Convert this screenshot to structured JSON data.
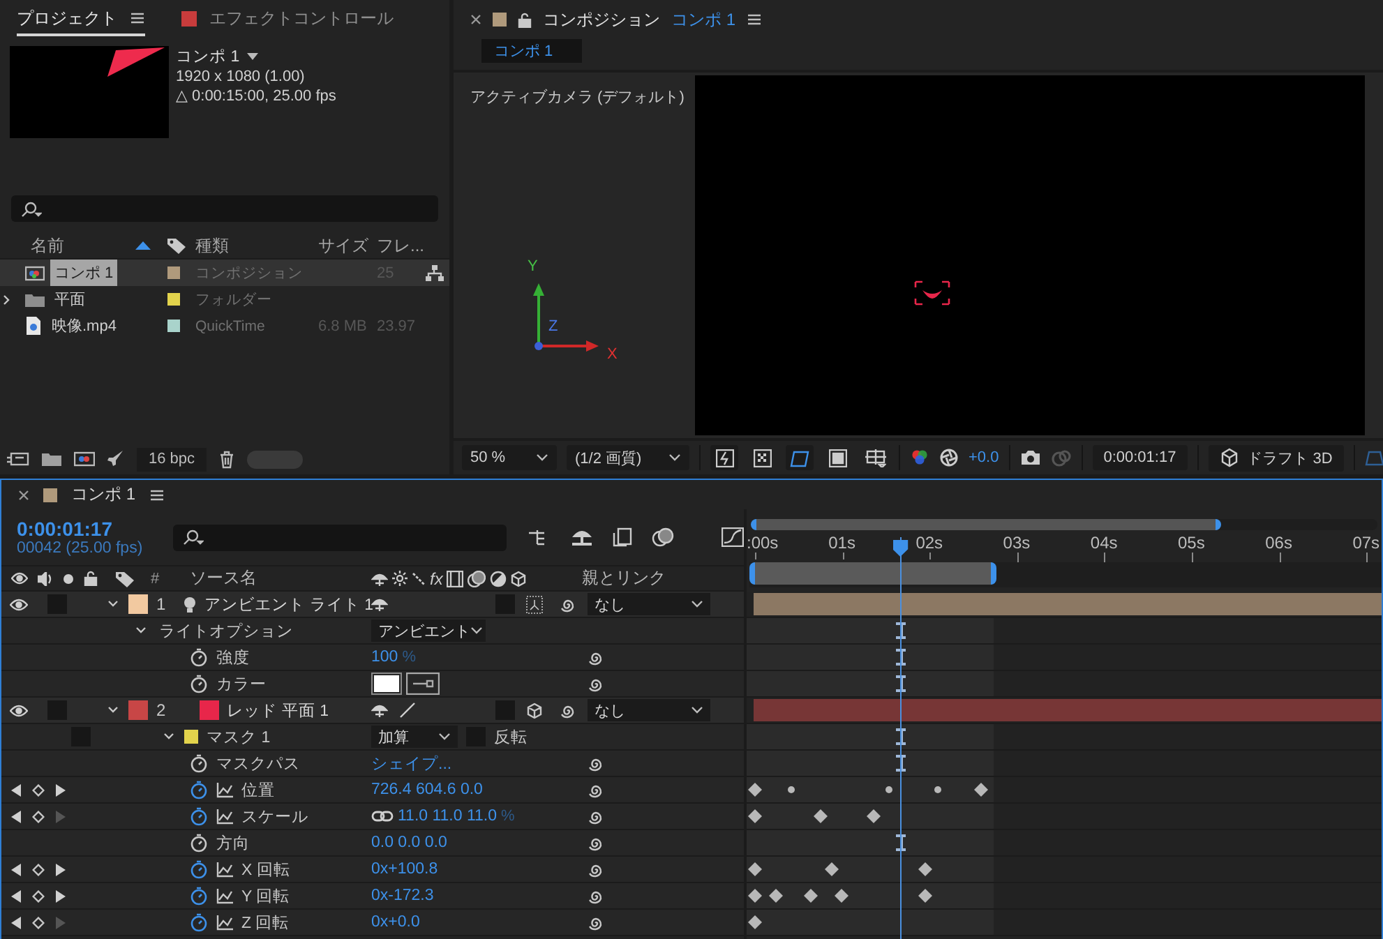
{
  "project": {
    "tabs": [
      {
        "label": "プロジェクト",
        "selected": true
      },
      {
        "label": "エフェクトコントロール",
        "selected": false
      }
    ],
    "preview": {
      "name": "コンポ 1",
      "resolution": "1920 x 1080 (1.00)",
      "duration": "△ 0:00:15:00, 25.00 fps"
    },
    "columns": [
      "名前",
      "種類",
      "サイズ",
      "フレ..."
    ],
    "items": [
      {
        "kind": "comp",
        "name": "コンポ 1",
        "color": "#b09a7c",
        "type": "コンポジション",
        "fps": "25",
        "selected": true
      },
      {
        "kind": "folder",
        "name": "平面",
        "color": "#e2d34c",
        "type": "フォルダー",
        "expanded": false,
        "selected": false
      },
      {
        "kind": "footage",
        "name": "映像.mp4",
        "color": "#a9d3cb",
        "type": "QuickTime",
        "size": "6.8 MB",
        "fps": "23.97",
        "selected": false
      }
    ],
    "bit_depth": "16 bpc"
  },
  "composition": {
    "title": "コンポジション",
    "comp_name": "コンポ 1",
    "tabs": [
      {
        "label": "コンポ 1",
        "selected": true
      }
    ],
    "view_label": "アクティブカメラ (デフォルト)",
    "axes": [
      "Y",
      "Z",
      "X"
    ],
    "zoom": "50 %",
    "resolution": "(1/2 画質)",
    "mask_view": true,
    "exposure": "+0.0",
    "time": "0:00:01:17",
    "renderer": "ドラフト 3D"
  },
  "timeline": {
    "comp_name": "コンポ 1",
    "timecode": "0:00:01:17",
    "frames": "00042 (25.00 fps)",
    "headers": {
      "number": "#",
      "source": "ソース名",
      "effects": "fx",
      "parent": "親とリンク"
    },
    "ruler": [
      ":00s",
      "01s",
      "02s",
      "03s",
      "04s",
      "05s",
      "06s",
      "07s"
    ],
    "navigator": {
      "level": 0.75
    },
    "work_area": {
      "level": 0.39
    },
    "playhead": {
      "level": 0.242
    },
    "layers": [
      {
        "kind": "light",
        "number": "1",
        "name": "アンビエント ライト 1",
        "color": "#f2c9a0",
        "visible": true,
        "expanded": true,
        "parent": "なし",
        "children": [
          {
            "kind": "group",
            "label": "ライトオプション",
            "value": "アンビエント",
            "expanded": true,
            "children": [
              {
                "kind": "property",
                "label": "強度",
                "value": "100",
                "unit": "%",
                "animated": false
              },
              {
                "kind": "color",
                "label": "カラー",
                "animated": false
              }
            ]
          }
        ]
      },
      {
        "kind": "solid",
        "number": "2",
        "name": "レッド 平面 1",
        "color": "#c84646",
        "visible": true,
        "expanded": true,
        "parent": "なし",
        "children": [
          {
            "kind": "mask",
            "label": "マスク 1",
            "color": "#e2d34c",
            "mode": "加算",
            "inverted": false,
            "invert_label": "反転",
            "expanded": true,
            "children": [
              {
                "kind": "property",
                "label": "マスクパス",
                "value": "シェイプ...",
                "animated": false
              }
            ]
          },
          {
            "kind": "property",
            "label": "位置",
            "value": "726.4 604.6 0.0",
            "animated": true,
            "keyframes": [
              {
                "kind": "diamond",
                "level": 0.013
              },
              {
                "kind": "dot",
                "level": 0.07
              },
              {
                "kind": "dot",
                "level": 0.225
              },
              {
                "kind": "dot",
                "level": 0.3
              },
              {
                "kind": "diamond",
                "level": 0.37
              }
            ]
          },
          {
            "kind": "property",
            "label": "スケール",
            "value": "11.0 11.0 11.0",
            "unit": "%",
            "linked": true,
            "animated": true,
            "keyframes": [
              {
                "kind": "diamond",
                "level": 0.013
              },
              {
                "kind": "diamond",
                "level": 0.117
              },
              {
                "kind": "diamond",
                "level": 0.2
              }
            ]
          },
          {
            "kind": "property",
            "label": "方向",
            "value": "0.0 0.0 0.0",
            "animated": false
          },
          {
            "kind": "property",
            "label": "X 回転",
            "value": "0x+100.8",
            "animated": true,
            "keyframes": [
              {
                "kind": "diamond",
                "level": 0.013
              },
              {
                "kind": "diamond",
                "level": 0.134
              },
              {
                "kind": "diamond",
                "level": 0.282
              }
            ]
          },
          {
            "kind": "property",
            "label": "Y 回転",
            "value": "0x-172.3",
            "animated": true,
            "keyframes": [
              {
                "kind": "diamond",
                "level": 0.013
              },
              {
                "kind": "diamond",
                "level": 0.046
              },
              {
                "kind": "diamond",
                "level": 0.1
              },
              {
                "kind": "diamond",
                "level": 0.15
              },
              {
                "kind": "diamond",
                "level": 0.282
              }
            ]
          },
          {
            "kind": "property",
            "label": "Z 回転",
            "value": "0x+0.0",
            "animated": true,
            "keyframes": [
              {
                "kind": "diamond",
                "level": 0.013
              }
            ]
          }
        ]
      }
    ]
  }
}
